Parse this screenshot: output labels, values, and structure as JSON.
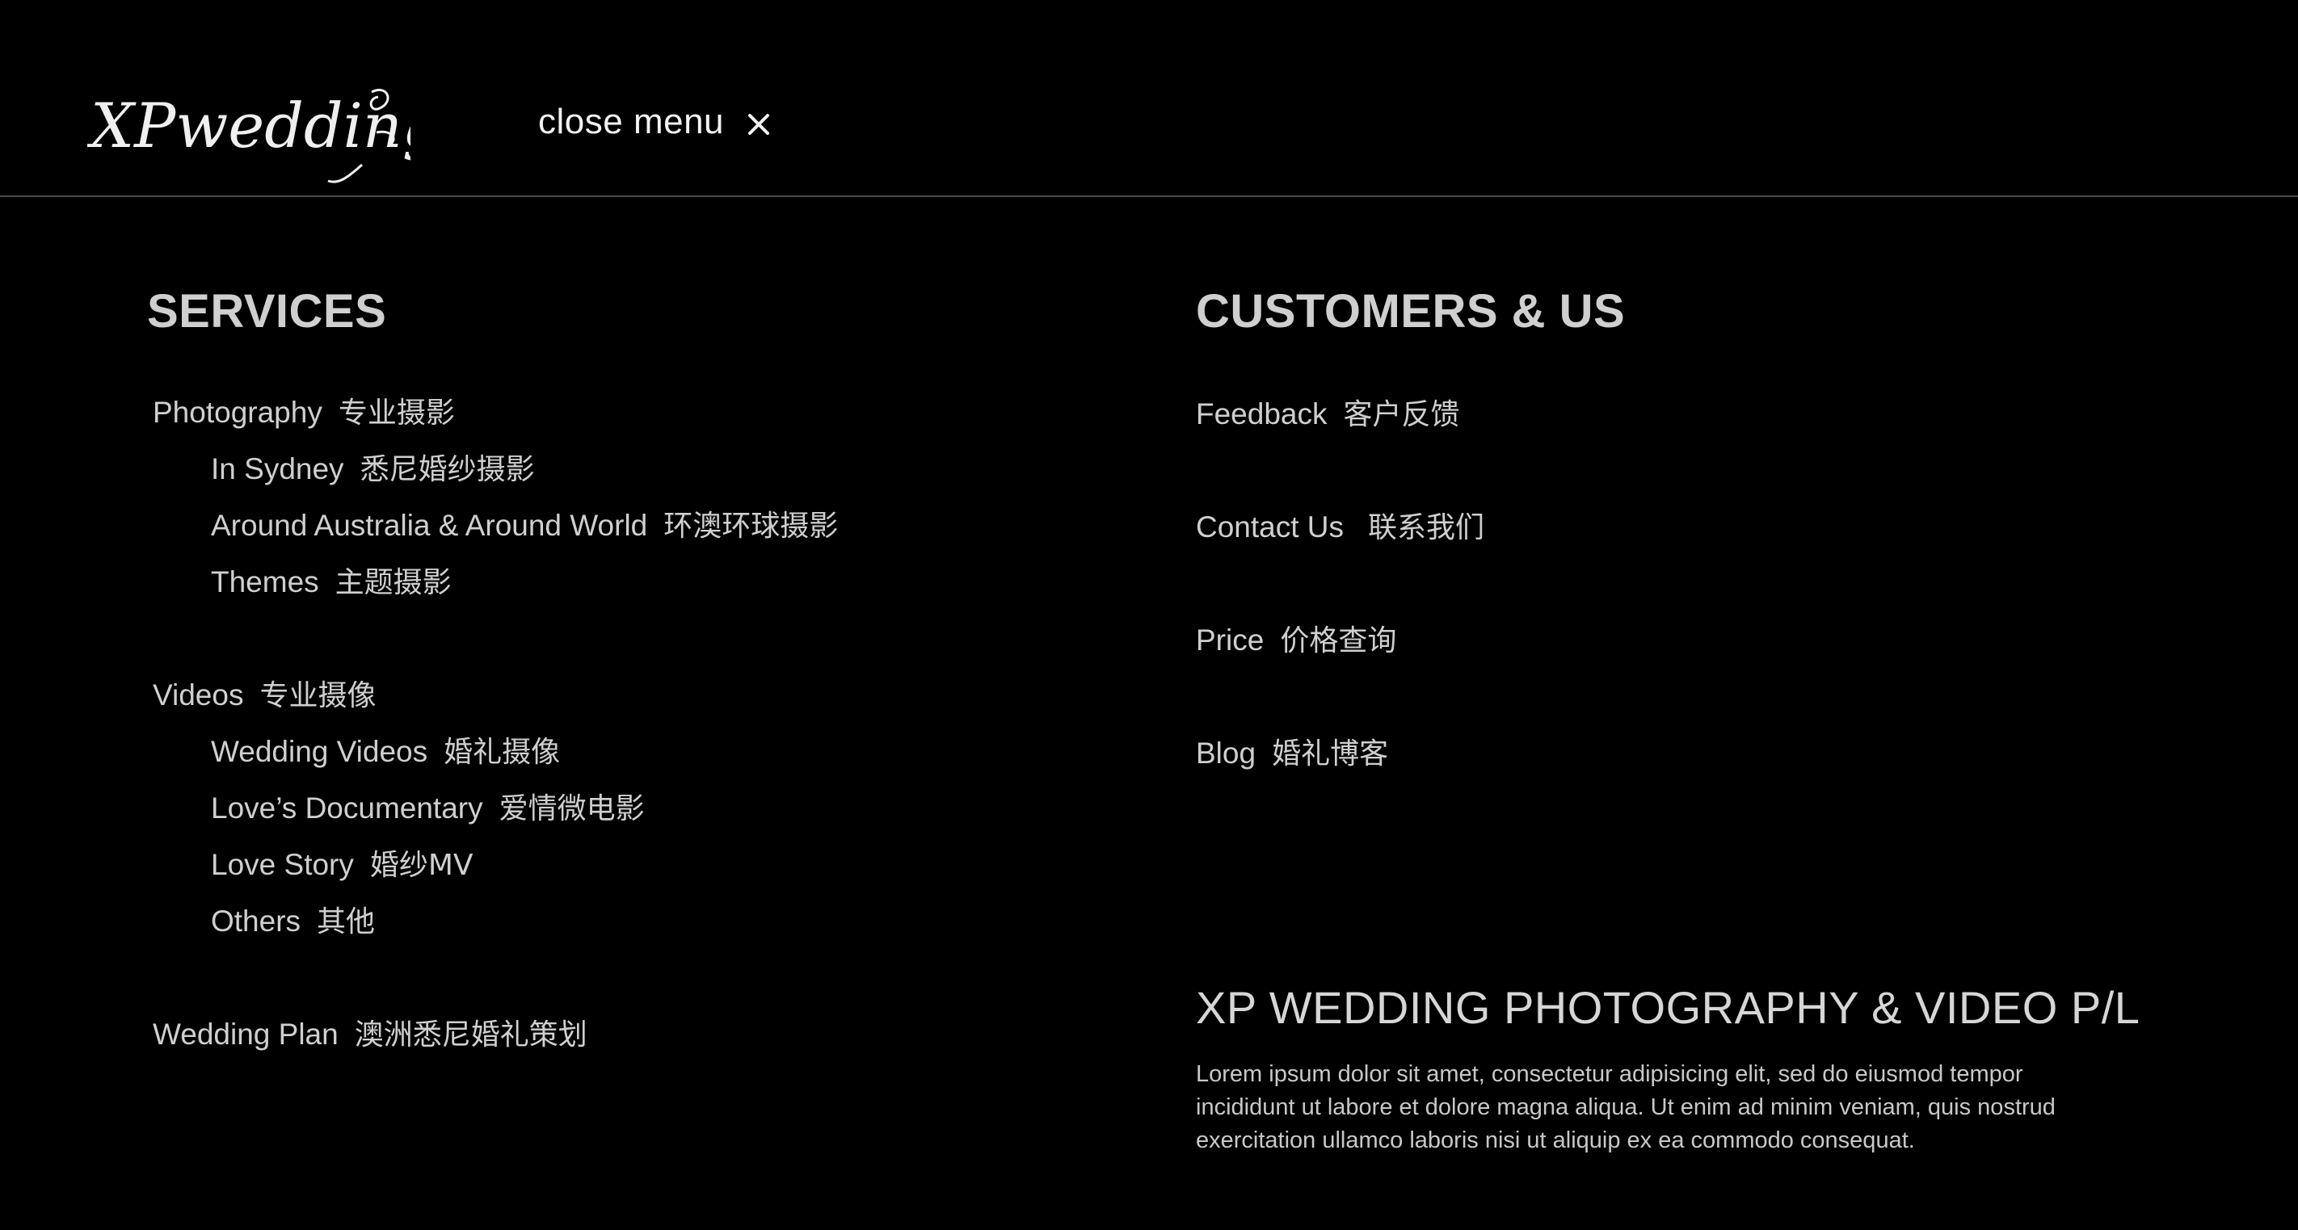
{
  "header": {
    "logo_text": "XPwedding",
    "close_label": "close menu"
  },
  "services": {
    "heading": "SERVICES",
    "photography": {
      "en": "Photography",
      "zh": "专业摄影"
    },
    "photo_items": [
      {
        "en": "In Sydney",
        "zh": "悉尼婚纱摄影"
      },
      {
        "en": "Around Australia & Around World",
        "zh": "环澳环球摄影"
      },
      {
        "en": "Themes",
        "zh": "主题摄影"
      }
    ],
    "videos": {
      "en": "Videos",
      "zh": "专业摄像"
    },
    "video_items": [
      {
        "en": "Wedding Videos",
        "zh": "婚礼摄像"
      },
      {
        "en": "Love’s Documentary",
        "zh": "爱情微电影"
      },
      {
        "en": "Love Story",
        "zh": "婚纱MV"
      },
      {
        "en": "Others",
        "zh": "其他"
      }
    ],
    "plan": {
      "en": "Wedding Plan",
      "zh": "澳洲悉尼婚礼策划"
    }
  },
  "customers": {
    "heading": "CUSTOMERS & US",
    "items": [
      {
        "en": "Feedback",
        "zh": "客户反馈"
      },
      {
        "en": "Contact Us",
        "zh": "联系我们"
      },
      {
        "en": "Price",
        "zh": "价格查询"
      },
      {
        "en": "Blog",
        "zh": "婚礼博客"
      }
    ]
  },
  "company": {
    "name": "XP WEDDING PHOTOGRAPHY & VIDEO P/L",
    "description": "Lorem ipsum dolor sit amet, consectetur adipisicing elit, sed do eiusmod tempor incididunt ut labore et dolore magna aliqua. Ut enim ad minim veniam, quis nostrud exercitation ullamco laboris nisi ut aliquip ex ea commodo consequat."
  }
}
